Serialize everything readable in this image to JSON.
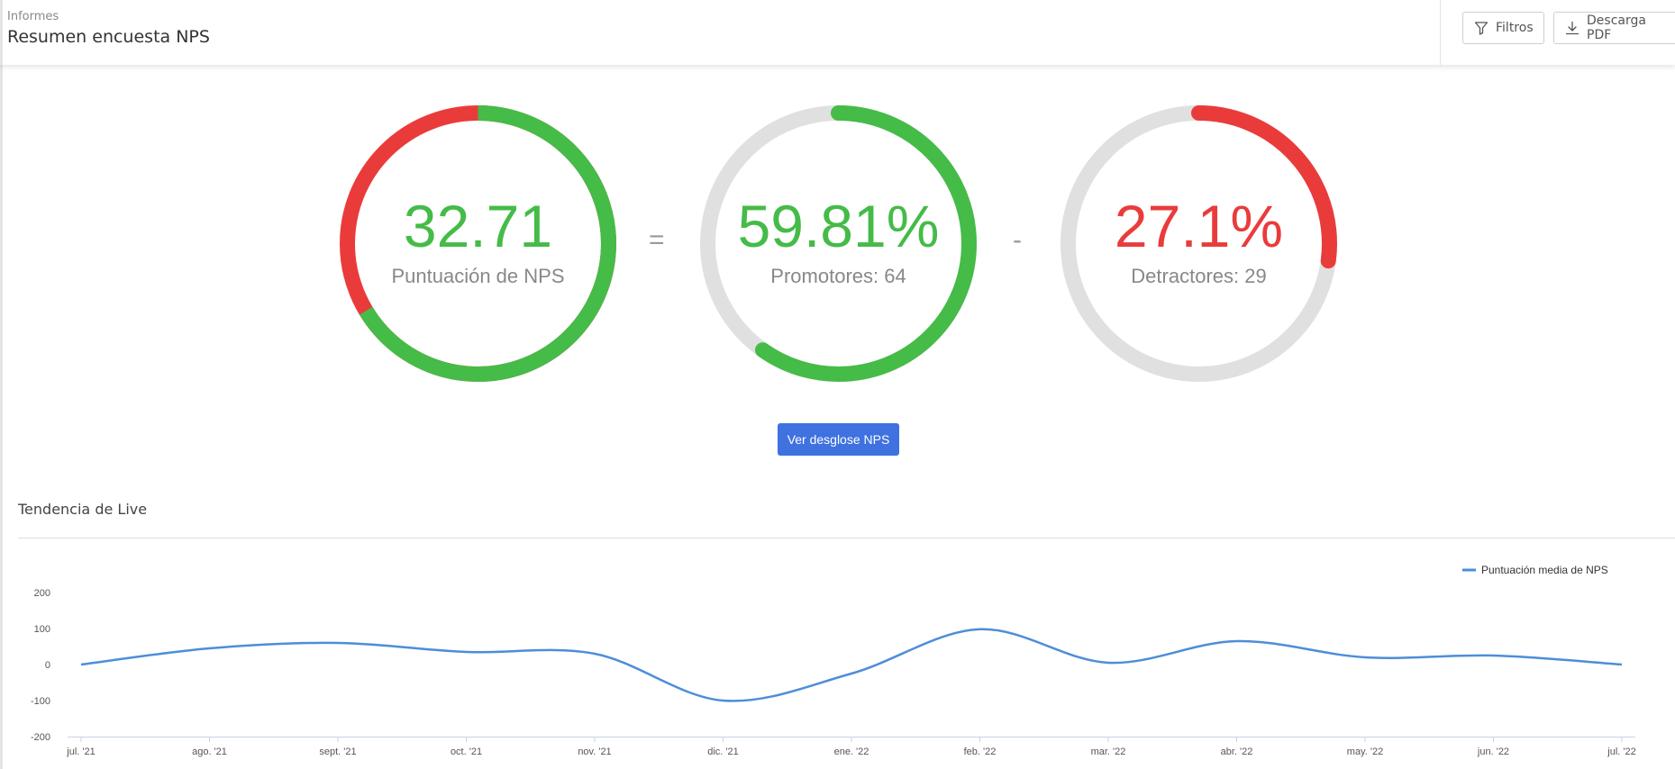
{
  "header": {
    "breadcrumb": "Informes",
    "title": "Resumen encuesta NPS",
    "filters_label": "Filtros",
    "pdf_label": "Descarga PDF"
  },
  "gauges": [
    {
      "value": "32.71",
      "label": "Puntuación de NPS",
      "color": "#45bb48",
      "fraction": 0.6636
    },
    {
      "value": "59.81%",
      "label": "Promotores: 64",
      "color": "#45bb48",
      "fraction": 0.5981
    },
    {
      "value": "27.1%",
      "label": "Detractores: 29",
      "color": "#ea3b3b",
      "fraction": 0.271
    }
  ],
  "operators": {
    "equals": "=",
    "minus": "-"
  },
  "colors": {
    "green": "#45bb48",
    "red": "#ea3b3b",
    "gray": "#e0e0e0",
    "primary": "#3f72e0",
    "line": "#4d8ed8"
  },
  "breakdown_button": "Ver desglose NPS",
  "trend": {
    "title": "Tendencia de Live"
  },
  "chart_data": {
    "type": "line",
    "title": "",
    "xlabel": "",
    "ylabel": "",
    "ylim": [
      -200,
      200
    ],
    "yticks": [
      200,
      100,
      0,
      -100,
      -200
    ],
    "grid": false,
    "legend_position": "top-right",
    "categories": [
      "jul. '21",
      "ago. '21",
      "sept. '21",
      "oct. '21",
      "nov. '21",
      "dic. '21",
      "ene. '22",
      "feb. '22",
      "mar. '22",
      "abr. '22",
      "may. '22",
      "jun. '22",
      "jul. '22"
    ],
    "series": [
      {
        "name": "Puntuación media de NPS",
        "values": [
          0,
          45,
          60,
          35,
          30,
          -100,
          -25,
          98,
          5,
          65,
          20,
          25,
          0
        ]
      }
    ]
  }
}
